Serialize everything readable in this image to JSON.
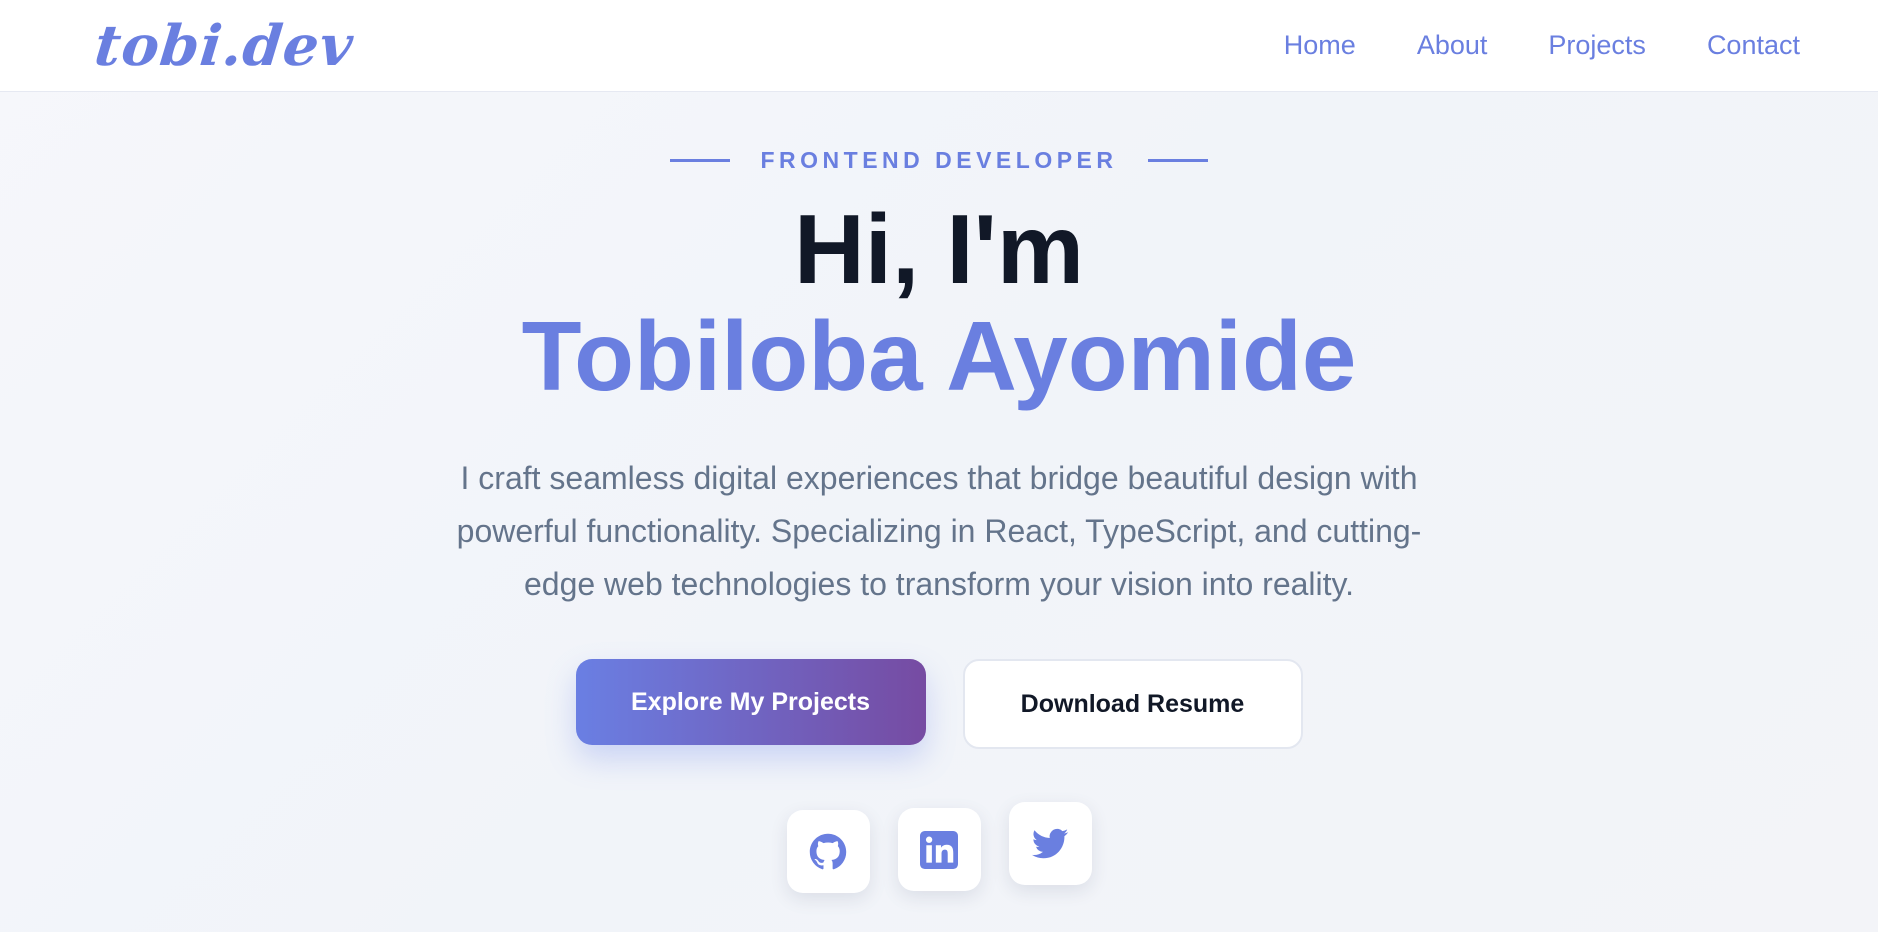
{
  "nav": {
    "logo": "tobi.dev",
    "links": [
      "Home",
      "About",
      "Projects",
      "Contact"
    ]
  },
  "hero": {
    "eyebrow": "FRONTEND DEVELOPER",
    "greeting": "Hi, I'm",
    "name": "Tobiloba Ayomide",
    "tagline": "I craft seamless digital experiences that bridge beautiful design with powerful functionality. Specializing in React, TypeScript, and cutting-edge web technologies to transform your vision into reality.",
    "primary_button": "Explore My Projects",
    "secondary_button": "Download Resume"
  },
  "social": [
    {
      "icon": "github-icon"
    },
    {
      "icon": "linkedin-icon"
    },
    {
      "icon": "twitter-icon"
    }
  ],
  "colors": {
    "accent": "#6a7fe0",
    "gradient_start": "#6a7fe3",
    "gradient_end": "#764ba2",
    "heading": "#111827",
    "body_text": "#64748b"
  }
}
